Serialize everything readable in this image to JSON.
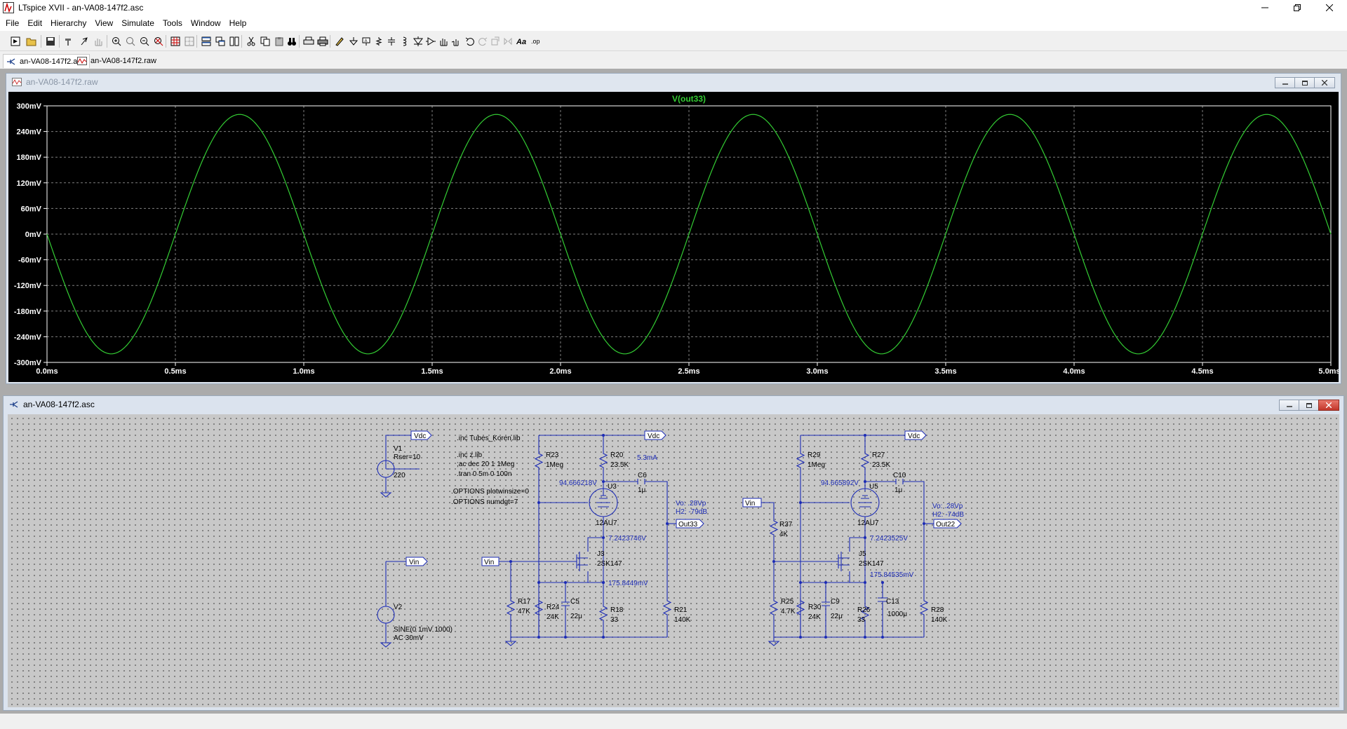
{
  "app": {
    "title": "LTspice XVII - an-VA08-147f2.asc"
  },
  "menu": [
    "File",
    "Edit",
    "Hierarchy",
    "View",
    "Simulate",
    "Tools",
    "Window",
    "Help"
  ],
  "tabs": [
    {
      "label": "an-VA08-147f2.asc"
    },
    {
      "label": "an-VA08-147f2.raw"
    }
  ],
  "waveform_window": {
    "title": "an-VA08-147f2.raw",
    "trace_label": "V(out33)",
    "trace_color": "#33cc33",
    "background": "#000000"
  },
  "chart_data": {
    "type": "line",
    "title": "",
    "series": [
      {
        "name": "V(out33)",
        "waveform": "sine",
        "frequency_hz": 1000,
        "amplitude_mV": 280,
        "offset_mV": 0,
        "phase": "inverted"
      }
    ],
    "xlim": [
      0.0,
      5.0
    ],
    "ylim": [
      -300,
      300
    ],
    "xticks": [
      "0.0ms",
      "0.5ms",
      "1.0ms",
      "1.5ms",
      "2.0ms",
      "2.5ms",
      "3.0ms",
      "3.5ms",
      "4.0ms",
      "4.5ms",
      "5.0ms"
    ],
    "yticks": [
      "300mV",
      "240mV",
      "180mV",
      "120mV",
      "60mV",
      "0mV",
      "-60mV",
      "-120mV",
      "-180mV",
      "-240mV",
      "-300mV"
    ],
    "grid": true
  },
  "schematic_window": {
    "title": "an-VA08-147f2.asc"
  },
  "schematic": {
    "directives": [
      ".inc Tubes_Koren.lib",
      ".inc z.lib",
      ";ac dec 20 1 1Meg",
      ".tran 0 5m 0 100n",
      ".OPTIONS plotwinsize=0",
      ".OPTIONS numdgt=7"
    ],
    "v1": {
      "name": "V1",
      "rser": "Rser=10",
      "value": "220"
    },
    "v2": {
      "name": "V2",
      "value1": "SINE(0 1mV 1000)",
      "value2": "AC 30mV"
    },
    "net_vdc": "Vdc",
    "net_vin": "Vin",
    "left": {
      "r23": "R23",
      "r23v": "1Meg",
      "r20": "R20",
      "r20v": "23.5K",
      "current": "5.3mA",
      "node_v": "94.666218V",
      "u": "U3",
      "uv": "12AU7",
      "c6": "C6",
      "c6v": "1μ",
      "vo": "Vo: .28Vp",
      "h2": "H2: -79dB",
      "out": "Out33",
      "node2": "7.2423746V",
      "j": "J3",
      "jv": "2SK147",
      "node3": "175.8449mV",
      "r17": "R17",
      "r17v": "47K",
      "r24": "R24",
      "r24v": "24K",
      "c5": "C5",
      "c5v": "22μ",
      "r18": "R18",
      "r18v": "33",
      "r21": "R21",
      "r21v": "140K"
    },
    "right": {
      "r29": "R29",
      "r29v": "1Meg",
      "r27": "R27",
      "r27v": "23.5K",
      "node_v": "94.665892V",
      "u": "U5",
      "uv": "12AU7",
      "c10": "C10",
      "c10v": "1μ",
      "vo": "Vo: .28Vp",
      "h2": "H2: -74dB",
      "out": "Out22",
      "r37": "R37",
      "r37v": "4K",
      "node2": "7.2423525V",
      "j": "J5",
      "jv": "2SK147",
      "node3": "175.84535mV",
      "r25": "R25",
      "r25v": "4.7K",
      "r30": "R30",
      "r30v": "24K",
      "c9": "C9",
      "c9v": "22μ",
      "r26": "R26",
      "r26v": "33",
      "c13": "C13",
      "c13v": "1000μ",
      "r28": "R28",
      "r28v": "140K"
    }
  }
}
